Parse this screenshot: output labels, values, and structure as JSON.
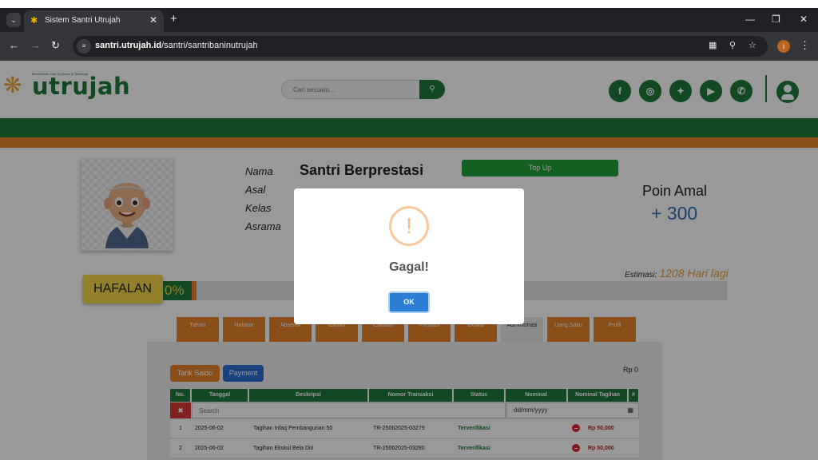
{
  "browser": {
    "tab_title": "Sistem Santri Utrujah",
    "url_host": "santri.utrujah.id",
    "url_path": "/santri/santribaninutrujah",
    "profile_initial": "i"
  },
  "header": {
    "logo_text": "utrujah",
    "logo_tagline": "Berkhidmat untuk Al-Quran & Teknologi",
    "search_placeholder": "Cari sesuatu..."
  },
  "profile": {
    "labels": [
      "Nama",
      "Asal",
      "Kelas",
      "Asrama"
    ],
    "name": "Santri Berprestasi",
    "topup_label": "Top Up",
    "poin_title": "Poin Amal",
    "poin_value": "+ 300"
  },
  "hafalan": {
    "label": "HAFALAN",
    "percent_text": "0%",
    "progress": 0,
    "estimasi_label": "Estimasi:",
    "estimasi_value": "1208 Hari lagi"
  },
  "menu_tabs": [
    {
      "label": "Tahsin"
    },
    {
      "label": "Hafalan"
    },
    {
      "label": "Absensi"
    },
    {
      "label": "Ibadah"
    },
    {
      "label": "Catatan"
    },
    {
      "label": "Prestasi"
    },
    {
      "label": "Ekskul"
    },
    {
      "label": "Administrasi"
    },
    {
      "label": "Uang Saku"
    },
    {
      "label": "Profil"
    }
  ],
  "administrasi": {
    "tarik_saldo_label": "Tarik Saldo",
    "payment_label": "Payment",
    "saldo": "Rp 0",
    "columns": [
      "No.",
      "Tanggal",
      "Deskripsi",
      "Nomor Transaksi",
      "Status",
      "Nominal",
      "Nominal Tagihan",
      "#"
    ],
    "search_placeholder": "Search",
    "date_placeholder": "dd/mm/yyyy",
    "rows": [
      {
        "no": "1",
        "tanggal": "2025-06-02",
        "deskripsi": "Tagihan Infaq Pembangunan 50",
        "nomor": "TR-25062025-03279",
        "status": "Terverifikasi",
        "nominal": "",
        "tagihan": "Rp 50,000"
      },
      {
        "no": "2",
        "tanggal": "2025-06-02",
        "deskripsi": "Tagihan Ekskul Bela Diri",
        "nomor": "TR-25062025-03280",
        "status": "Terverifikasi",
        "nominal": "",
        "tagihan": "Rp 50,000"
      }
    ]
  },
  "dialog": {
    "title": "Gagal!",
    "ok_label": "OK"
  },
  "colors": {
    "brand_green": "#1f7a3a",
    "brand_orange": "#e8822a",
    "accent_yellow": "#f3d64a"
  }
}
